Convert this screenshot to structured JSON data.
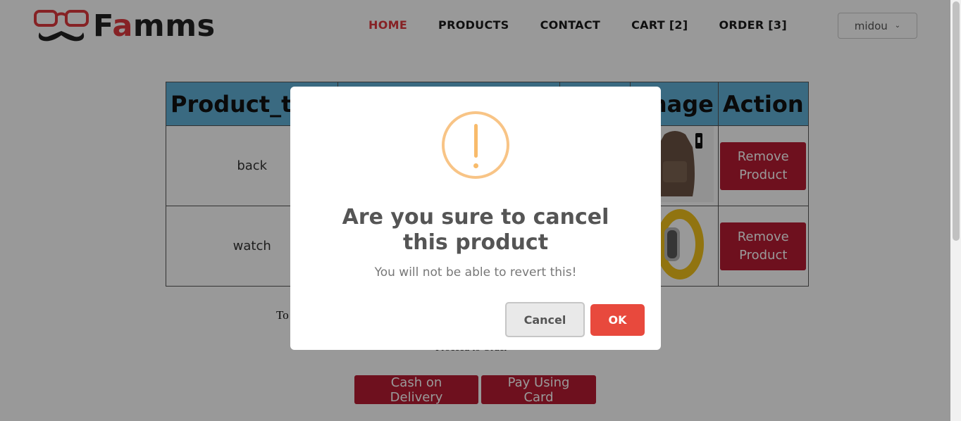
{
  "brand": {
    "name_prefix": "F",
    "name_accent": "a",
    "name_suffix": "mms"
  },
  "nav": {
    "items": [
      {
        "label": "HOME",
        "active": true
      },
      {
        "label": "PRODUCTS",
        "active": false
      },
      {
        "label": "CONTACT",
        "active": false
      },
      {
        "label": "CART [2]",
        "active": false
      },
      {
        "label": "ORDER [3]",
        "active": false
      }
    ]
  },
  "user": {
    "name": "midou"
  },
  "table": {
    "headers": [
      "Product_title",
      "",
      "",
      "Image",
      "Action"
    ],
    "rows": [
      {
        "title": "back",
        "image_icon": "backpack-image",
        "action": "Remove Product"
      },
      {
        "title": "watch",
        "image_icon": "watch-image",
        "action": "Remove Product"
      }
    ]
  },
  "summary": {
    "total_label": "To",
    "proceed_label": "Proceed to Order"
  },
  "payment": {
    "cash_label": "Cash on Delivery",
    "card_label": "Pay Using Card"
  },
  "dialog": {
    "title": "Are you sure to cancel this product",
    "text": "You will not be able to revert this!",
    "cancel_label": "Cancel",
    "ok_label": "OK",
    "icon": "warning-icon"
  },
  "colors": {
    "accent": "#e03a3e",
    "primary_button": "#b81c33",
    "header_bg": "#61b1d8",
    "ok_button": "#e8493d",
    "warning": "#f8bb6b"
  }
}
